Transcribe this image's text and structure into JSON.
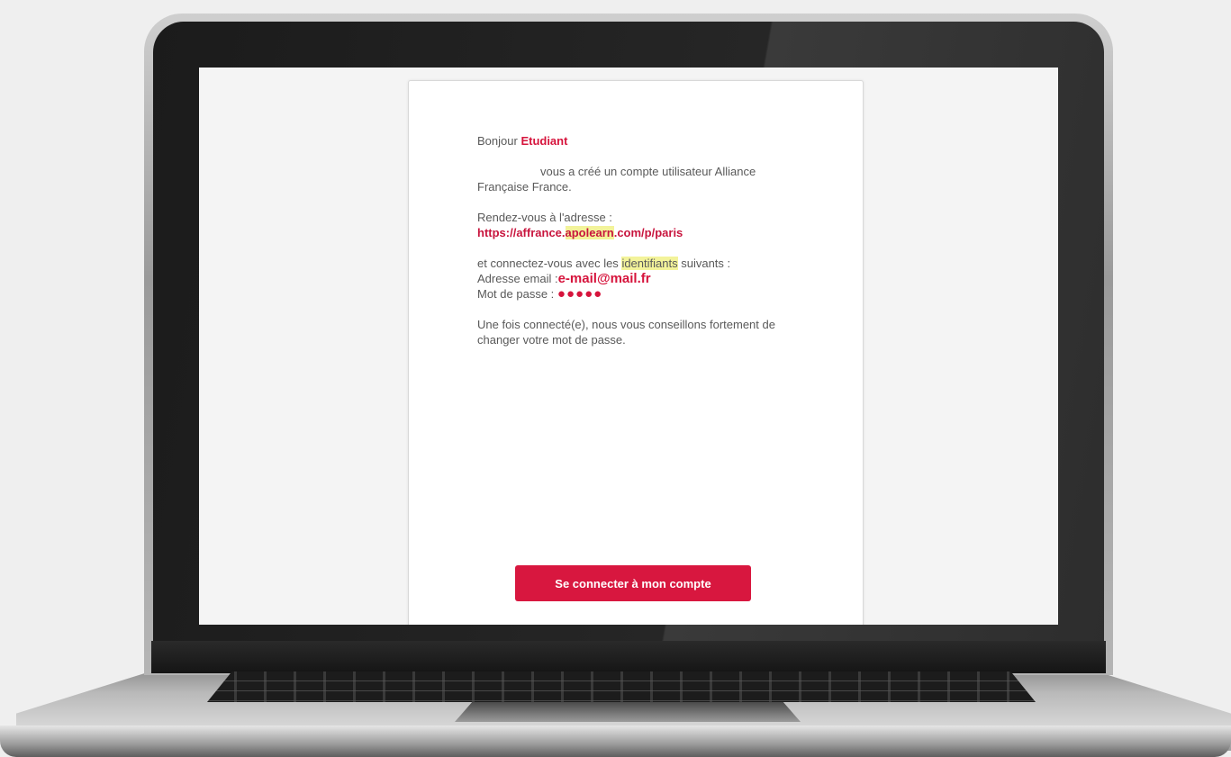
{
  "email": {
    "greeting_word": "Bonjour",
    "recipient": "Etudiant",
    "intro": "vous a créé un compte utilisateur Alliance Française France.",
    "visit_prefix": "Rendez-vous à l'adresse :",
    "url_part1": "https://affrance.",
    "url_part2": "apolearn",
    "url_part3": ".com/p/paris",
    "connect_prefix": "et connectez-vous avec les",
    "connect_highlight": "identifiants",
    "connect_suffix": "suivants :",
    "email_label": "Adresse email :",
    "email_value": "e-mail@mail.fr",
    "password_label": "Mot de passe :",
    "password_value": "●●●●●",
    "advice": "Une fois connecté(e), nous vous conseillons fortement de changer votre mot de passe.",
    "cta_label": "Se connecter à mon compte"
  },
  "colors": {
    "accent": "#d8173f",
    "text": "#595959",
    "highlight": "#f3f39a"
  }
}
